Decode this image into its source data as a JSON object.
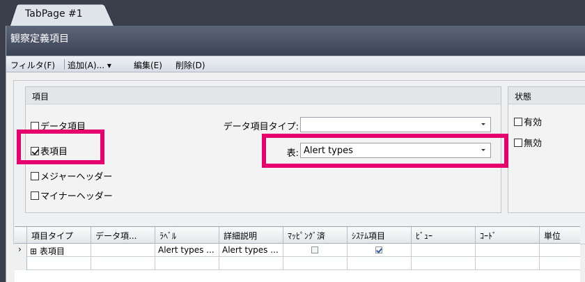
{
  "tab": {
    "label": "TabPage #1"
  },
  "panel": {
    "title": "観察定義項目"
  },
  "toolbar": {
    "filter_label": "フィルタ(F)",
    "add_label": "追加(A)... ▾",
    "edit_label": "編集(E)",
    "delete_label": "削除(D)"
  },
  "items_group": {
    "title": "項目",
    "checkboxes": [
      {
        "label": "データ項目",
        "checked": false
      },
      {
        "label": "表項目",
        "checked": true
      },
      {
        "label": "メジャーヘッダー",
        "checked": false
      },
      {
        "label": "マイナーヘッダー",
        "checked": false
      }
    ],
    "data_item_type_label": "データ項目タイプ:",
    "data_item_type_value": "",
    "table_label": "表:",
    "table_value": "Alert types"
  },
  "status_group": {
    "title": "状態",
    "checkboxes": [
      {
        "label": "有効",
        "checked": false
      },
      {
        "label": "無効",
        "checked": false
      }
    ]
  },
  "grid": {
    "columns": [
      "項目タイプ",
      "データ項...",
      "ﾗﾍﾞﾙ",
      "詳細説明",
      "ﾏｯﾋﾟﾝｸﾞ済",
      "ｼｽﾃﾑ項目",
      "ﾋﾞｭｰ",
      "ｺｰﾄﾞ",
      "単位"
    ],
    "rows": [
      {
        "indicator": "›",
        "expand": "⊞",
        "item_type": "表項目",
        "data_item": "",
        "label": "Alert types ...",
        "description": "Alert types ...",
        "mapped": false,
        "system_item": true,
        "view": "",
        "code": "",
        "unit": ""
      }
    ]
  },
  "colors": {
    "highlight": "#e6006e",
    "titlebar": "#4a5265"
  }
}
